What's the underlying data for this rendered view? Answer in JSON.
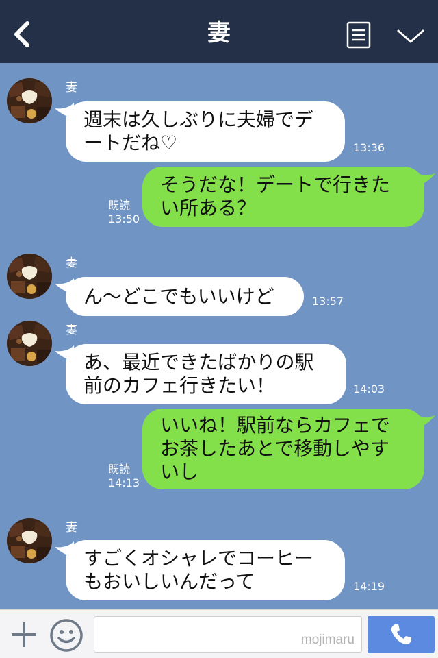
{
  "header": {
    "title": "妻"
  },
  "messages": [
    {
      "sender": "妻",
      "lines": [
        "週末は久しぶりに夫婦でデ",
        "ートだね♡"
      ],
      "time": "13:36"
    },
    {
      "lines": [
        "そうだな！デートで行きた",
        "い所ある？"
      ],
      "read": "既読",
      "time": "13:50"
    },
    {
      "sender": "妻",
      "lines": [
        "ん〜どこでもいいけど"
      ],
      "time": "13:57"
    },
    {
      "sender": "妻",
      "lines": [
        "あ、最近できたばかりの駅",
        "前のカフェ行きたい！"
      ],
      "time": "14:03"
    },
    {
      "lines": [
        "いいね！駅前ならカフェで",
        "お茶したあとで移動しやす",
        "いし"
      ],
      "read": "既読",
      "time": "14:13"
    },
    {
      "sender": "妻",
      "lines": [
        "すごくオシャレでコーヒー",
        "もおいしいんだって"
      ],
      "time": "14:19"
    }
  ],
  "input": {
    "value": ""
  },
  "watermark": "mojimaru",
  "colors": {
    "background": "#7094c4",
    "header": "#233048",
    "incoming": "#ffffff",
    "outgoing": "#84e04a",
    "call_button": "#5b8ae0"
  },
  "icons": {
    "back": "back-arrow-icon",
    "menu": "menu-list-icon",
    "collapse": "chevron-down-icon",
    "add": "plus-icon",
    "sticker": "smiley-icon",
    "call": "phone-icon"
  }
}
